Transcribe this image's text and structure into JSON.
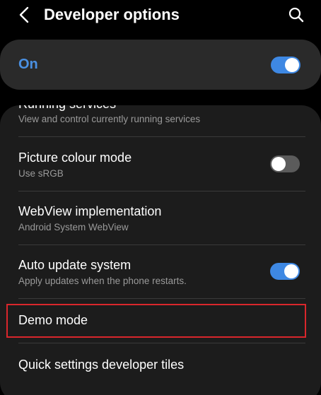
{
  "appbar": {
    "title": "Developer options",
    "back_icon": "arrow-left-icon",
    "search_icon": "search-icon"
  },
  "master": {
    "label": "On",
    "enabled": true,
    "accent_color": "#4a90e2"
  },
  "items": [
    {
      "title": "Running services",
      "summary": "View and control currently running services"
    },
    {
      "title": "Picture colour mode",
      "summary": "Use sRGB",
      "toggle": false
    },
    {
      "title": "WebView implementation",
      "summary": "Android System WebView"
    },
    {
      "title": "Auto update system",
      "summary": "Apply updates when the phone restarts.",
      "toggle": true
    },
    {
      "title": "Demo mode",
      "highlighted": true,
      "highlight_color": "#d9262c"
    },
    {
      "title": "Quick settings developer tiles"
    }
  ]
}
